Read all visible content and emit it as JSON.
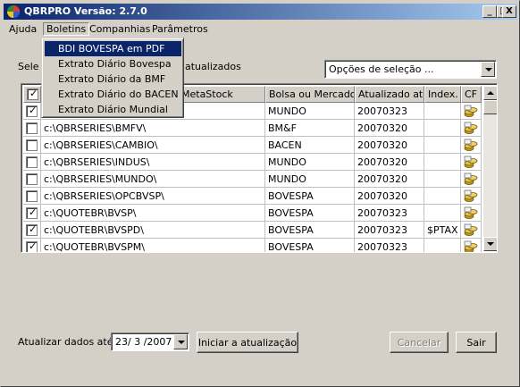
{
  "window": {
    "title": "QBRPRO Versão: 2.7.0",
    "minimize": "_",
    "maximize": "□",
    "close": "X"
  },
  "menu": {
    "items": [
      "Ajuda",
      "Boletins",
      "Companhias",
      "Parâmetros"
    ]
  },
  "dropdown": {
    "items": [
      "BDI BOVESPA em PDF",
      "Extrato Diário Bovespa",
      "Extrato Diário da BMF",
      "Extrato Diário do BACEN",
      "Extrato Diário Mundial"
    ],
    "selected_index": 0
  },
  "filter": {
    "label_left": "Sele",
    "label_right": "atualizados",
    "select_value": "Opções de seleção ..."
  },
  "grid": {
    "columns": [
      "",
      "MetaStock",
      "Bolsa ou Mercado",
      "Atualizado até",
      "Index.",
      "CF"
    ],
    "header_checked": true,
    "rows": [
      {
        "checked": true,
        "path": "",
        "market": "MUNDO",
        "updated": "20070323",
        "index": ""
      },
      {
        "checked": false,
        "path": "c:\\QBRSERIES\\BMFV\\",
        "market": "BM&F",
        "updated": "20070320",
        "index": ""
      },
      {
        "checked": false,
        "path": "c:\\QBRSERIES\\CAMBIO\\",
        "market": "BACEN",
        "updated": "20070320",
        "index": ""
      },
      {
        "checked": false,
        "path": "c:\\QBRSERIES\\INDUS\\",
        "market": "MUNDO",
        "updated": "20070320",
        "index": ""
      },
      {
        "checked": false,
        "path": "c:\\QBRSERIES\\MUNDO\\",
        "market": "MUNDO",
        "updated": "20070320",
        "index": ""
      },
      {
        "checked": false,
        "path": "c:\\QBRSERIES\\OPCBVSP\\",
        "market": "BOVESPA",
        "updated": "20070320",
        "index": ""
      },
      {
        "checked": true,
        "path": "c:\\QUOTEBR\\BVSP\\",
        "market": "BOVESPA",
        "updated": "20070323",
        "index": ""
      },
      {
        "checked": true,
        "path": "c:\\QUOTEBR\\BVSPD\\",
        "market": "BOVESPA",
        "updated": "20070323",
        "index": "$PTAX"
      },
      {
        "checked": true,
        "path": "c:\\QUOTEBR\\BVSPM\\",
        "market": "BOVESPA",
        "updated": "20070323",
        "index": ""
      }
    ]
  },
  "footer": {
    "date_label": "Atualizar dados até:",
    "date_value": "23/ 3 /2007",
    "start_button": "Iniciar a atualização",
    "cancel_button": "Cancelar",
    "exit_button": "Sair"
  },
  "colors": {
    "title_bar_start": "#0a246a",
    "title_bar_end": "#a6caf0",
    "window_face": "#d4d0c8",
    "menu_highlight": "#0a246a"
  }
}
